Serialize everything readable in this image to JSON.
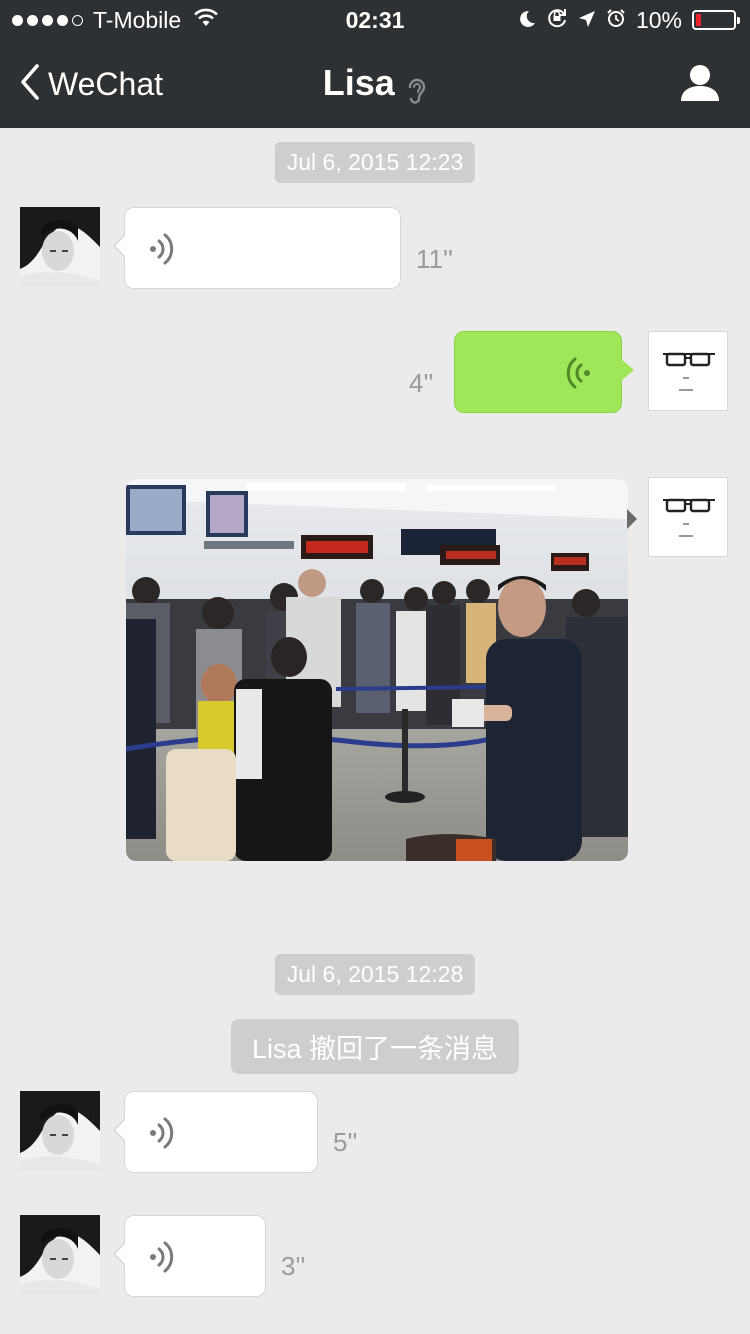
{
  "status_bar": {
    "carrier": "T-Mobile",
    "time": "02:31",
    "battery": "10%",
    "signal_bars_filled": 4,
    "signal_bars_total": 5,
    "icons": [
      "wifi-icon",
      "moon-icon",
      "rotation-lock-icon",
      "location-arrow-icon",
      "alarm-icon",
      "battery-icon"
    ]
  },
  "nav": {
    "back_label": "WeChat",
    "title": "Lisa",
    "title_icon": "earpiece-icon",
    "right_icon": "profile-icon"
  },
  "chat": {
    "timestamps": [
      "Jul 6, 2015 12:23",
      "Jul 6, 2015 12:28"
    ],
    "messages": [
      {
        "from": "Lisa",
        "type": "voice",
        "duration": "11''"
      },
      {
        "from": "me",
        "type": "voice",
        "duration": "4''"
      },
      {
        "from": "me",
        "type": "image",
        "description_icon": "photo"
      },
      {
        "from": "Lisa",
        "type": "voice",
        "duration": "5''"
      },
      {
        "from": "Lisa",
        "type": "voice",
        "duration": "3''"
      }
    ],
    "recall_notice": "Lisa 撤回了一条消息"
  },
  "colors": {
    "nav_bg": "#2e3134",
    "chat_bg": "#ebebeb",
    "outgoing_bubble": "#9fe658",
    "incoming_bubble": "#ffffff",
    "system_pill": "#cecece",
    "battery_low": "#e8232b"
  }
}
